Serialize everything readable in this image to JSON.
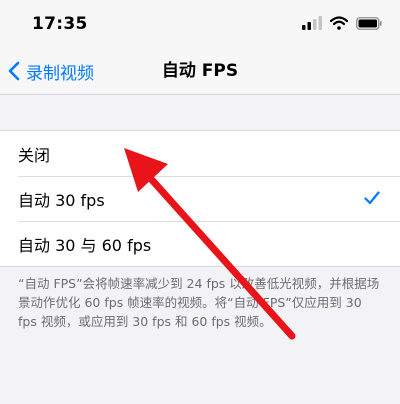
{
  "status_bar": {
    "time": "17:35",
    "icons": [
      "signal-icon",
      "wifi-icon",
      "battery-icon"
    ]
  },
  "nav_bar": {
    "back_label": "录制视频",
    "title": "自动 FPS"
  },
  "options": [
    {
      "label": "关闭",
      "selected": false
    },
    {
      "label": "自动 30 fps",
      "selected": true
    },
    {
      "label": "自动 30 与 60 fps",
      "selected": false
    }
  ],
  "footnote": "“自动 FPS”会将帧速率减少到 24 fps 以改善低光视频，并根据场景动作优化 60 fps 帧速率的视频。将“自动 FPS”仅应用到 30 fps 视频，或应用到 30 fps 和 60 fps 视频。",
  "colors": {
    "accent": "#007aff",
    "annotation_arrow": "#e8141a",
    "background": "#f2f2f7"
  }
}
